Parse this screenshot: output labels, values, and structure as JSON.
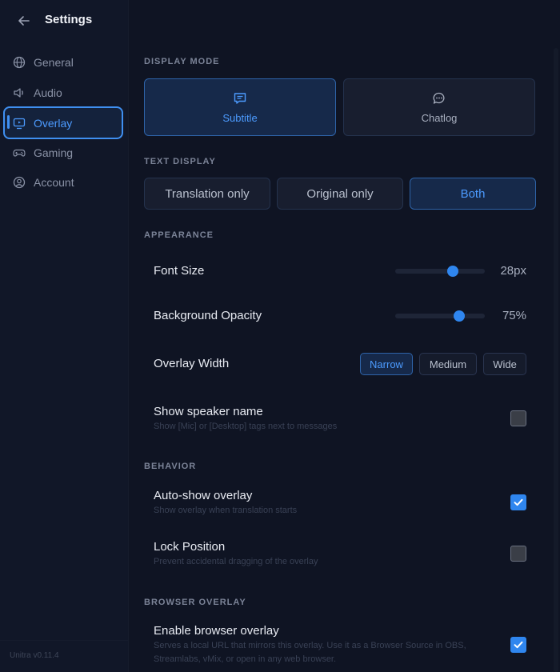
{
  "header": {
    "title": "Settings"
  },
  "sidebar": {
    "items": [
      {
        "label": "General",
        "icon": "globe-icon"
      },
      {
        "label": "Audio",
        "icon": "speaker-icon"
      },
      {
        "label": "Overlay",
        "icon": "monitor-icon"
      },
      {
        "label": "Gaming",
        "icon": "gamepad-icon"
      },
      {
        "label": "Account",
        "icon": "user-circle-icon"
      }
    ],
    "active": "Overlay",
    "version": "Unitra v0.11.4"
  },
  "display_mode": {
    "label": "DISPLAY MODE",
    "options": [
      {
        "label": "Subtitle",
        "icon": "subtitle-icon"
      },
      {
        "label": "Chatlog",
        "icon": "chat-bubble-icon"
      }
    ],
    "selected": "Subtitle"
  },
  "text_display": {
    "label": "TEXT DISPLAY",
    "options": [
      "Translation only",
      "Original only",
      "Both"
    ],
    "selected": "Both"
  },
  "appearance": {
    "label": "APPEARANCE",
    "font_size": {
      "label": "Font Size",
      "value": "28px",
      "fraction": 0.64
    },
    "background_opacity": {
      "label": "Background Opacity",
      "value": "75%",
      "fraction": 0.71
    },
    "overlay_width": {
      "label": "Overlay Width",
      "options": [
        "Narrow",
        "Medium",
        "Wide"
      ],
      "selected": "Narrow"
    },
    "show_speaker_name": {
      "label": "Show speaker name",
      "desc": "Show [Mic] or [Desktop] tags next to messages",
      "checked": false
    }
  },
  "behavior": {
    "label": "BEHAVIOR",
    "auto_show": {
      "label": "Auto-show overlay",
      "desc": "Show overlay when translation starts",
      "checked": true
    },
    "lock_position": {
      "label": "Lock Position",
      "desc": "Prevent accidental dragging of the overlay",
      "checked": false
    }
  },
  "browser_overlay": {
    "label": "BROWSER OVERLAY",
    "enable": {
      "label": "Enable browser overlay",
      "desc": "Serves a local URL that mirrors this overlay. Use it as a Browser Source in OBS, Streamlabs, vMix, or open in any web browser.",
      "checked": true
    }
  },
  "colors": {
    "accent": "#2f86ef",
    "accent_text": "#4c9bff",
    "background": "#0f1423",
    "sidebar": "#111728"
  }
}
